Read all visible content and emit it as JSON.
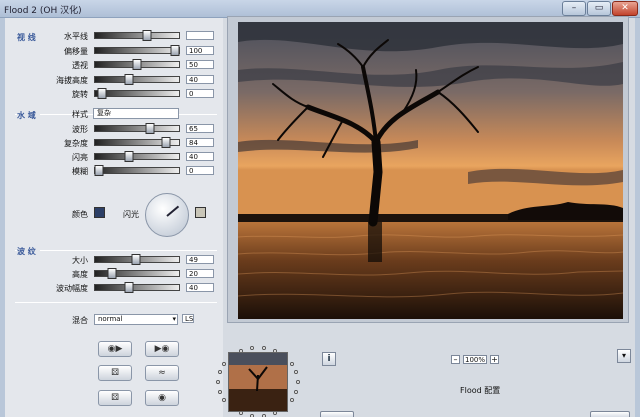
{
  "window": {
    "title": "Flood 2 (OH 汉化)",
    "min": "–",
    "max": "▭",
    "close": "✕"
  },
  "sections": {
    "view": "视 线",
    "water": "水 域",
    "waves": "波 纹"
  },
  "view_rows": [
    {
      "label": "水平线",
      "value": "",
      "pos": 0.62
    },
    {
      "label": "偏移量",
      "value": "100",
      "pos": 0.95
    },
    {
      "label": "透视",
      "value": "50",
      "pos": 0.5
    },
    {
      "label": "海拔高度",
      "value": "40",
      "pos": 0.4
    },
    {
      "label": "旋转",
      "value": "0",
      "pos": 0.08
    }
  ],
  "style": {
    "label": "样式",
    "value": "复杂"
  },
  "water_rows": [
    {
      "label": "波形",
      "value": "65",
      "pos": 0.65
    },
    {
      "label": "复杂度",
      "value": "84",
      "pos": 0.84
    },
    {
      "label": "闪亮",
      "value": "40",
      "pos": 0.4
    },
    {
      "label": "模糊",
      "value": "0",
      "pos": 0.05
    }
  ],
  "color": {
    "label": "颜色",
    "glint_label": "闪光",
    "color_hex": "#2c3f66",
    "glint_hex": "#c9c6b8"
  },
  "wave_rows": [
    {
      "label": "大小",
      "value": "49",
      "pos": 0.49
    },
    {
      "label": "高度",
      "value": "20",
      "pos": 0.2
    },
    {
      "label": "波动幅度",
      "value": "40",
      "pos": 0.4
    }
  ],
  "blend": {
    "label": "混合",
    "value": "normal",
    "aux": "LS"
  },
  "toolbar": {
    "b1": "◉▶",
    "b2": "▶◉",
    "b3": "⚄",
    "b4": "≈",
    "b5": "⚄",
    "b6": "◉"
  },
  "zoom": {
    "minus": "–",
    "value": "100%",
    "plus": "+"
  },
  "info": "i",
  "flood_label": "Flood 配置",
  "corner": "▾"
}
